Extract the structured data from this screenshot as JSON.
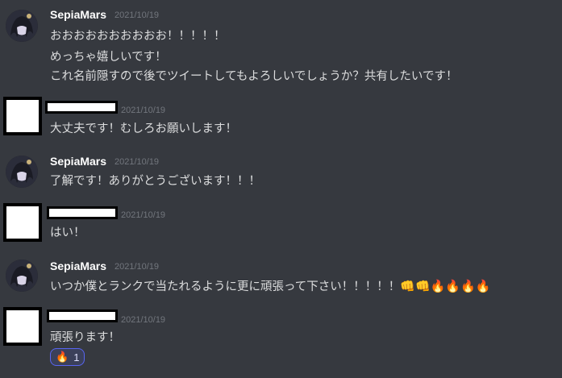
{
  "messages": [
    {
      "author": "SepiaMars",
      "timestamp": "2021/10/19",
      "lines": [
        "おおおおおおおおおお！！！！！",
        "めっちゃ嬉しいです！",
        "これ名前隠すので後でツイートしてもよろしいでしょうか？共有したいです！"
      ]
    },
    {
      "author": "",
      "timestamp": "2021/10/19",
      "lines": [
        "大丈夫です！むしろお願いします！"
      ]
    },
    {
      "author": "SepiaMars",
      "timestamp": "2021/10/19",
      "lines": [
        "了解です！ありがとうございます！！！"
      ]
    },
    {
      "author": "",
      "timestamp": "2021/10/19",
      "lines": [
        "はい！"
      ]
    },
    {
      "author": "SepiaMars",
      "timestamp": "2021/10/19",
      "lines": [
        "いつか僕とランクで当たれるように更に頑張って下さい！！！！！"
      ],
      "emojis": [
        "👊",
        "👊",
        "🔥",
        "🔥",
        "🔥",
        "🔥"
      ]
    },
    {
      "author": "",
      "timestamp": "2021/10/19",
      "lines": [
        "頑張ります！"
      ],
      "reaction": {
        "emoji": "🔥",
        "count": "1"
      }
    }
  ],
  "colors": {
    "background": "#36393f",
    "username": "#ffffff",
    "timestamp": "#72767d",
    "text": "#dcddde",
    "reaction_border": "#5865f2"
  }
}
